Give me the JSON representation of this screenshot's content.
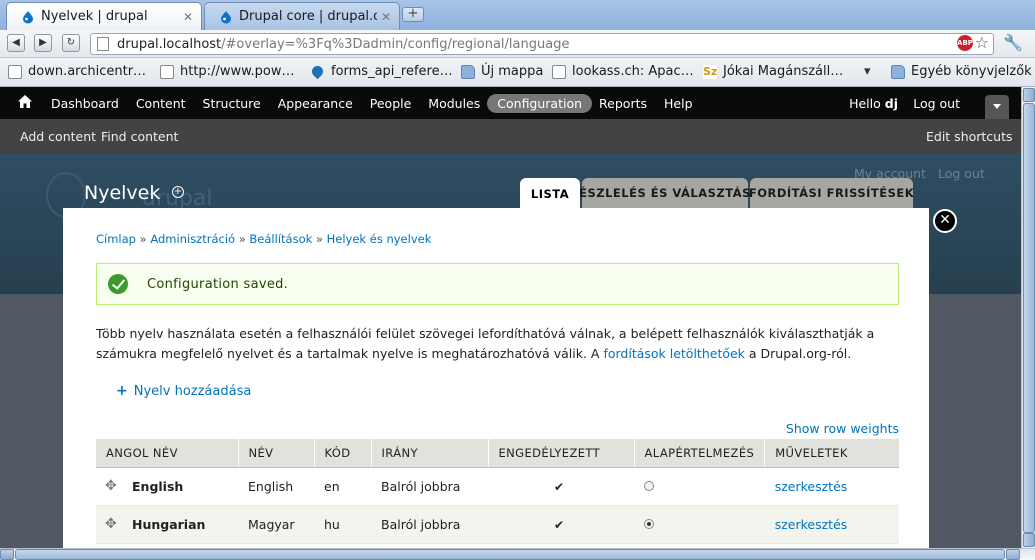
{
  "browser": {
    "tabs": [
      {
        "title": "Nyelvek | drupal",
        "close": "✕"
      },
      {
        "title": "Drupal core | drupal.org",
        "close": "✕"
      }
    ],
    "new_tab": "+",
    "address": {
      "host": "drupal.localhost",
      "path": "/#overlay=%3Fq%3Dadmin/config/regional/language"
    },
    "abp_label": "ABP",
    "bookmarks": [
      {
        "label": "down.archicentr…",
        "icon": "page-icon"
      },
      {
        "label": "http://www.pow…",
        "icon": "page-icon"
      },
      {
        "label": "forms_api_refere…",
        "icon": "drupal-icon"
      },
      {
        "label": "Új mappa",
        "icon": "folder-icon"
      },
      {
        "label": "lookass.ch: Apac…",
        "icon": "page-icon"
      },
      {
        "label": "Jókai Magánszáll…",
        "icon": "sz-icon"
      },
      {
        "label": "Egyéb könyvjelzők",
        "icon": "folder-icon"
      }
    ],
    "bookmarks_more": "▾",
    "sz_glyph": "Sz"
  },
  "toolbar": {
    "menu": [
      "Dashboard",
      "Content",
      "Structure",
      "Appearance",
      "People",
      "Modules",
      "Configuration",
      "Reports",
      "Help"
    ],
    "active_index": 6,
    "hello_prefix": "Hello ",
    "user": "dj",
    "logout": "Log out"
  },
  "shortcuts": {
    "add_content": "Add content",
    "find_content": "Find content",
    "edit_shortcuts": "Edit shortcuts"
  },
  "background": {
    "my_account": "My account",
    "log_out": "Log out",
    "site_name": "drupal"
  },
  "page": {
    "title": "Nyelvek",
    "tabs": [
      "LISTA",
      "ÉSZLELÉS ÉS VÁLASZTÁS",
      "FORDÍTÁSI FRISSÍTÉSEK"
    ],
    "close": "✕"
  },
  "breadcrumb": [
    "Címlap",
    "Adminisztráció",
    "Beállítások",
    "Helyek és nyelvek"
  ],
  "breadcrumb_sep": " » ",
  "message": "Configuration saved.",
  "help": {
    "text_before": "Több nyelv használata esetén a felhasználói felület szövegei lefordíthatóvá válnak, a belépett felhasználók kiválaszthatják a számukra megfelelő nyelvet és a tartalmak nyelve is meghatározhatóvá válik. A ",
    "link": "fordítások letölthetőek",
    "text_after": " a Drupal.org-ról."
  },
  "add_language": {
    "plus": "+",
    "label": "Nyelv hozzáadása"
  },
  "row_weights": "Show row weights",
  "table": {
    "headers": [
      "ANGOL NÉV",
      "NÉV",
      "KÓD",
      "IRÁNY",
      "ENGEDÉLYEZETT",
      "ALAPÉRTELMEZÉS",
      "MŰVELETEK"
    ],
    "rows": [
      {
        "english": "English",
        "name": "English",
        "code": "en",
        "direction": "Balról jobbra",
        "enabled": "✔",
        "default": false,
        "op": "szerkesztés"
      },
      {
        "english": "Hungarian",
        "name": "Magyar",
        "code": "hu",
        "direction": "Balról jobbra",
        "enabled": "✔",
        "default": true,
        "op": "szerkesztés"
      }
    ]
  }
}
